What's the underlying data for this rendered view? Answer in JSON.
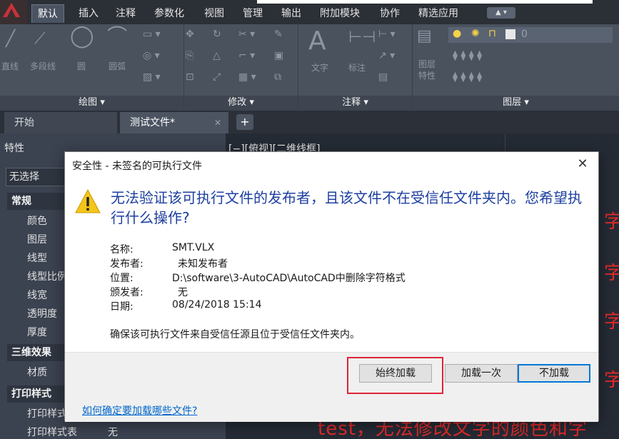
{
  "ribbon": {
    "tabs": [
      "默认",
      "插入",
      "注释",
      "参数化",
      "视图",
      "管理",
      "输出",
      "附加模块",
      "协作",
      "精选应用"
    ],
    "active_tab": "默认",
    "panels": {
      "draw": "绘图",
      "modify": "修改",
      "annotate": "注释",
      "layers": "图层"
    },
    "tools": {
      "line": "直线",
      "polyline": "多段线",
      "circle": "圆",
      "arc": "圆弧",
      "text": "文字",
      "dimension": "标注",
      "layer_props": "图层\n特性",
      "layer_value": "0"
    },
    "panel_arrow": "▾"
  },
  "doc_tabs": {
    "start": "开始",
    "test_file": "测试文件*",
    "close_glyph": "✕",
    "add_glyph": "+"
  },
  "properties": {
    "title": "特性",
    "selection": "无选择",
    "categories": {
      "general": "常规",
      "threed": "三维效果",
      "plot": "打印样式"
    },
    "rows": [
      "颜色",
      "图层",
      "线型",
      "线型比例",
      "线宽",
      "透明度",
      "厚度",
      "材质",
      "打印样式",
      "打印样式表"
    ],
    "plot_table_value": "无"
  },
  "canvas": {
    "view_label": "[−][俯视][二维线框]",
    "red_text": "test，无法修改文字的颜色和字",
    "red_char": "字"
  },
  "dialog": {
    "title": "安全性 - 未签名的可执行文件",
    "heading_line1": "无法验证该可执行文件的发布者，且该文件不在受信任文件夹内。您希望执",
    "heading_line2": "行什么操作?",
    "fields": [
      {
        "label": "名称:",
        "value": "SMT.VLX"
      },
      {
        "label": "发布者:",
        "value": "未知发布者"
      },
      {
        "label": "位置:",
        "value": "D:\\software\\3-AutoCAD\\AutoCAD中删除字符格式"
      },
      {
        "label": "颁发者:",
        "value": "无"
      },
      {
        "label": "日期:",
        "value": "08/24/2018  15:14"
      }
    ],
    "note": "确保该可执行文件来自受信任源且位于受信任文件夹内。",
    "buttons": {
      "always_load": "始终加载",
      "load_once": "加载一次",
      "do_not_load": "不加载"
    },
    "help_link": "如何确定要加载哪些文件?",
    "close_glyph": "✕"
  },
  "colors": {
    "highlight": "#e0233a",
    "heading": "#1d3fa0",
    "link": "#0066cc",
    "annotation_red": "#e22a2a"
  }
}
